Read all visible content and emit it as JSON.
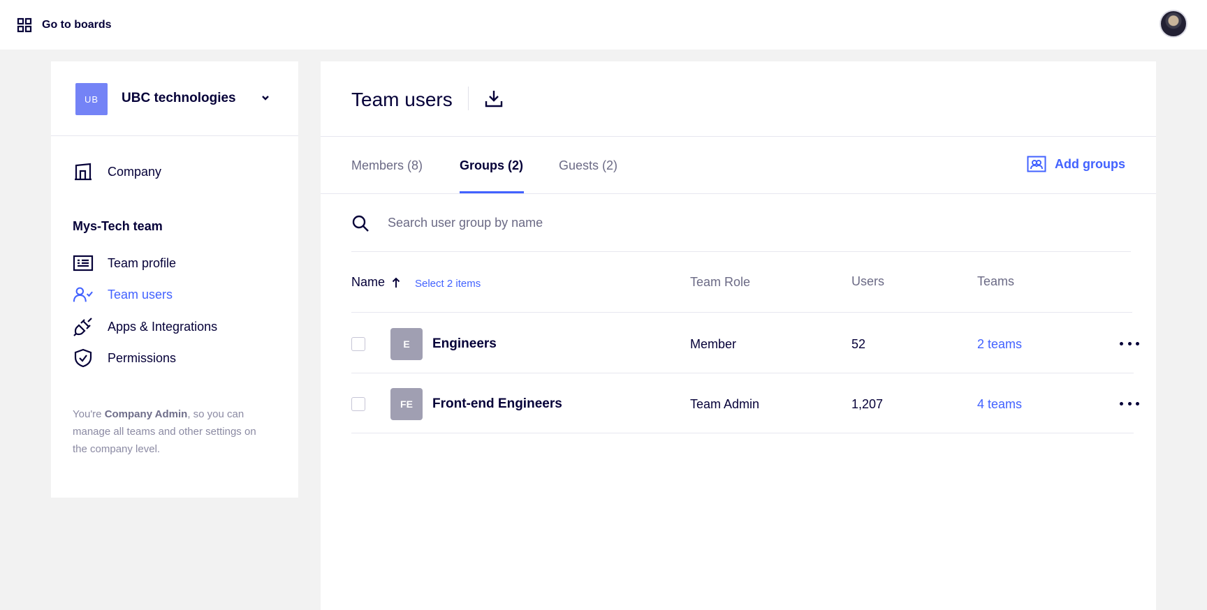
{
  "topbar": {
    "go_to_boards": "Go to boards"
  },
  "sidebar": {
    "org": {
      "initials": "UB",
      "name": "UBC technologies"
    },
    "company_label": "Company",
    "team_heading": "Mys-Tech team",
    "items": [
      {
        "label": "Team profile",
        "icon": "id-card-icon"
      },
      {
        "label": "Team users",
        "icon": "user-check-icon",
        "active": true
      },
      {
        "label": "Apps & Integrations",
        "icon": "plug-icon"
      },
      {
        "label": "Permissions",
        "icon": "shield-check-icon"
      }
    ],
    "admin_note": {
      "prefix": "You're ",
      "role": "Company Admin",
      "suffix": ", so you can manage all teams and other settings on the company level."
    }
  },
  "main": {
    "title": "Team users",
    "tabs": [
      {
        "label": "Members (8)"
      },
      {
        "label": "Groups (2)",
        "active": true
      },
      {
        "label": "Guests (2)"
      }
    ],
    "add_groups": "Add groups",
    "search": {
      "placeholder": "Search user group by name",
      "value": ""
    },
    "table": {
      "columns": {
        "name": "Name",
        "select": "Select 2 items",
        "role": "Team Role",
        "users": "Users",
        "teams": "Teams"
      },
      "rows": [
        {
          "initials": "E",
          "name": "Engineers",
          "role": "Member",
          "users": "52",
          "teams": "2 teams"
        },
        {
          "initials": "FE",
          "name": "Front-end Engineers",
          "role": "Team Admin",
          "users": "1,207",
          "teams": "4 teams"
        }
      ]
    }
  },
  "colors": {
    "accent": "#4262ff",
    "text": "#050038",
    "org_logo": "#7483f6",
    "group_avatar": "#a09fb2"
  }
}
